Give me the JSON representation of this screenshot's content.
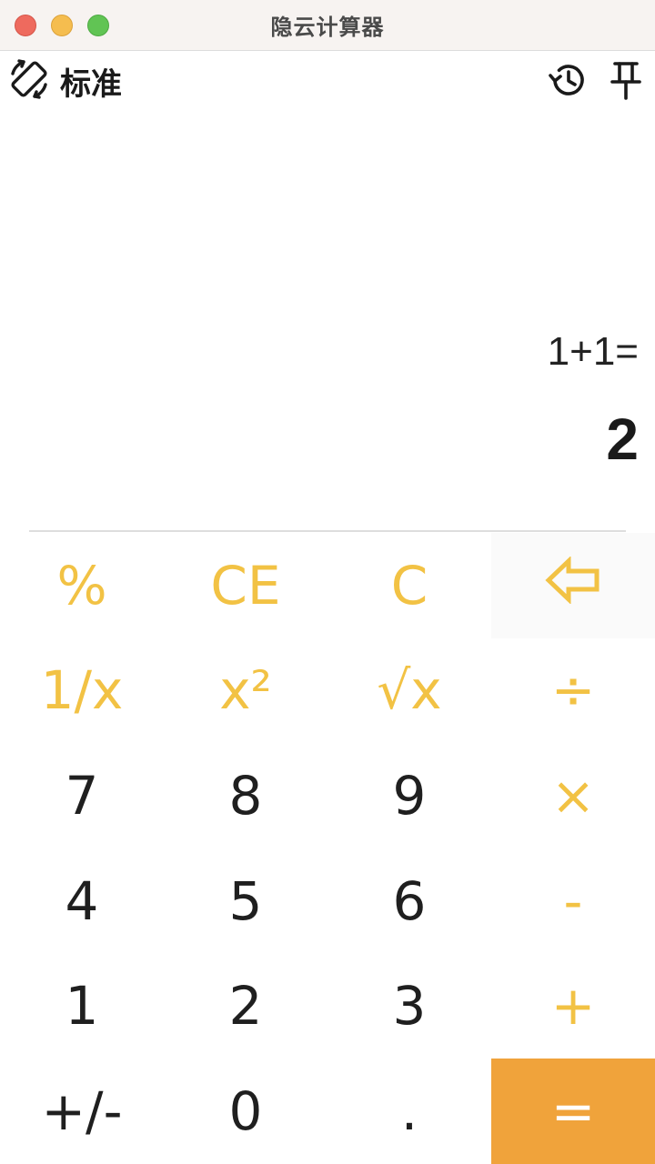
{
  "window": {
    "title": "隐云计算器"
  },
  "toolbar": {
    "mode_label": "标准",
    "mode_icon": "rotate-icon",
    "history_icon": "history-icon",
    "pin_icon": "pin-icon"
  },
  "display": {
    "expression": "1+1=",
    "result": "2"
  },
  "keys": {
    "percent": "%",
    "clear_entry": "CE",
    "clear": "C",
    "backspace_icon": "backspace-arrow-icon",
    "reciprocal": "1/x",
    "square": "x²",
    "sqrt": "√x",
    "divide": "÷",
    "seven": "7",
    "eight": "8",
    "nine": "9",
    "multiply": "×",
    "four": "4",
    "five": "5",
    "six": "6",
    "minus": "-",
    "one": "1",
    "two": "2",
    "three": "3",
    "plus": "+",
    "negate": "+/-",
    "zero": "0",
    "decimal": ".",
    "equals": "="
  },
  "colors": {
    "accent": "#f2c244",
    "equals_bg": "#f0a33b",
    "titlebar_bg": "#f7f3f1",
    "close": "#ee6a5e",
    "minimize": "#f5bd4f",
    "zoom": "#61c454"
  }
}
